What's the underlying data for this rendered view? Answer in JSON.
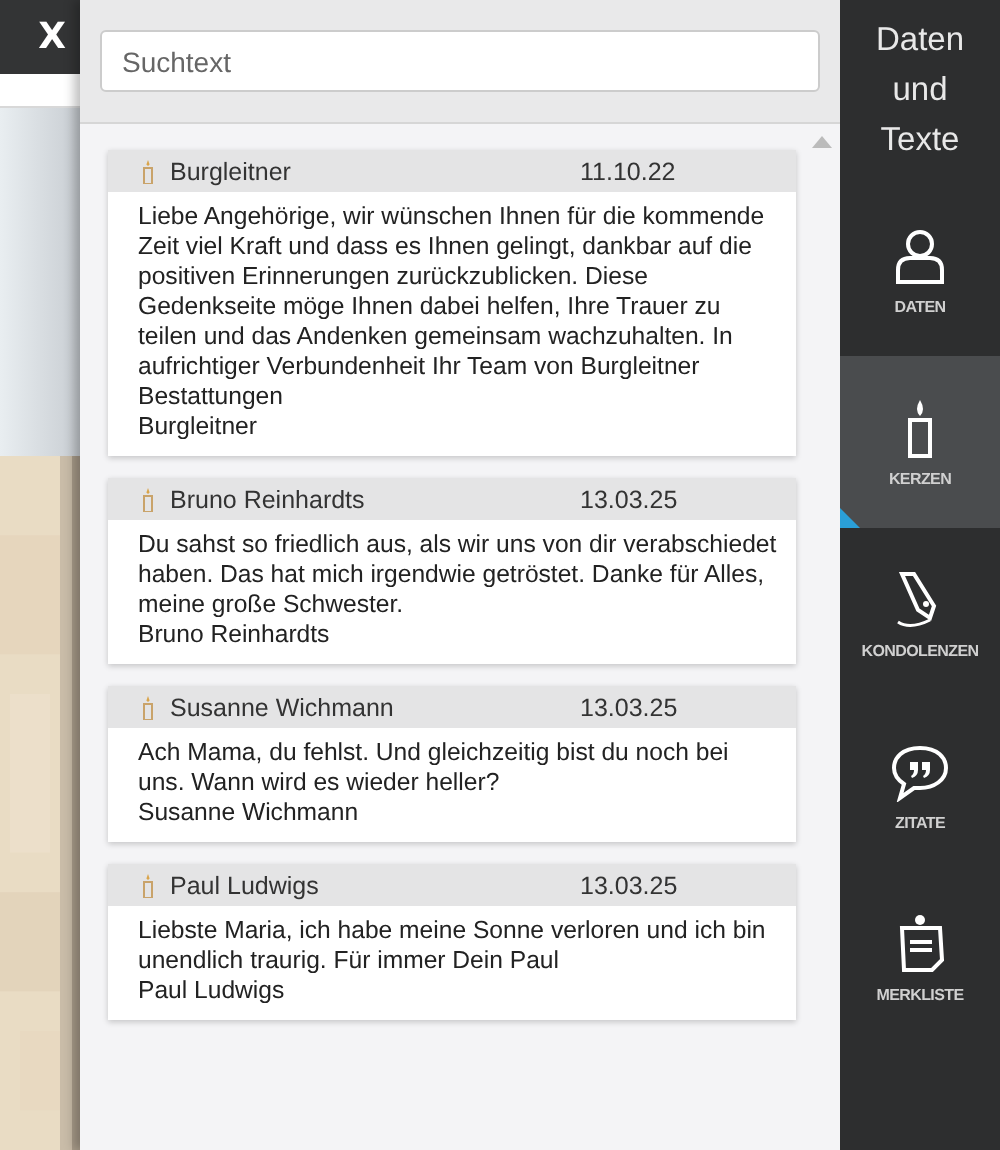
{
  "background_page": {
    "close_label": "X",
    "kind": "picture"
  },
  "search": {
    "placeholder": "Suchtext"
  },
  "entries": [
    {
      "name": "Burgleitner",
      "date": "11.10.22",
      "message": "Liebe Angehörige, wir wünschen Ihnen für die kommende Zeit viel Kraft und dass es Ihnen gelingt, dankbar auf die positiven Erinnerungen zurückzublicken. Diese Gedenkseite möge Ihnen dabei helfen, Ihre Trauer zu teilen und das Andenken gemeinsam wachzuhalten. In aufrichtiger Verbundenheit Ihr Team von Burgleitner Bestattungen",
      "signature": "Burgleitner"
    },
    {
      "name": "Bruno Reinhardts",
      "date": "13.03.25",
      "message": "Du sahst so friedlich aus, als wir uns von dir verabschiedet haben. Das hat mich irgendwie getröstet. Danke für Alles, meine große Schwester.",
      "signature": "Bruno Reinhardts"
    },
    {
      "name": "Susanne Wichmann",
      "date": "13.03.25",
      "message": "Ach Mama, du fehlst. Und gleichzeitig bist du noch bei uns. Wann wird es wieder heller?",
      "signature": "Susanne Wichmann"
    },
    {
      "name": "Paul Ludwigs",
      "date": "13.03.25",
      "message": "Liebste Maria, ich habe meine Sonne verloren und ich bin unendlich traurig. Für immer Dein Paul",
      "signature": "Paul Ludwigs"
    }
  ],
  "sidebar": {
    "title": "Daten und Texte",
    "items": [
      {
        "label": "DATEN",
        "kind": "person",
        "selected": false
      },
      {
        "label": "KERZEN",
        "kind": "candle",
        "selected": true
      },
      {
        "label": "KONDOLENZEN",
        "kind": "pen",
        "selected": false
      },
      {
        "label": "ZITATE",
        "kind": "quote",
        "selected": false
      },
      {
        "label": "MERKLISTE",
        "kind": "note",
        "selected": false
      }
    ]
  }
}
